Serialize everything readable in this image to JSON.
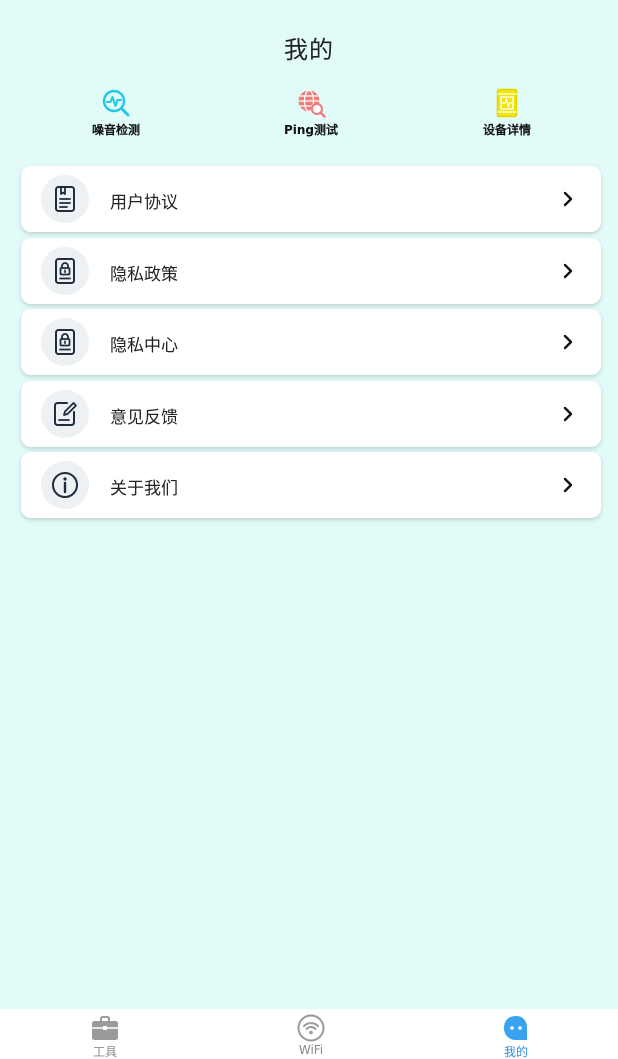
{
  "header": {
    "title": "我的"
  },
  "tools": [
    {
      "label": "噪音检测",
      "icon": "noise-search-icon",
      "color": "#1ec8e6"
    },
    {
      "label": "Ping测试",
      "icon": "globe-search-icon",
      "color": "#f07b7b"
    },
    {
      "label": "设备详情",
      "icon": "phone-device-icon",
      "color": "#f0e60a"
    }
  ],
  "menu": [
    {
      "label": "用户协议",
      "icon": "document-icon"
    },
    {
      "label": "隐私政策",
      "icon": "lock-document-icon"
    },
    {
      "label": "隐私中心",
      "icon": "lock-document-icon"
    },
    {
      "label": "意见反馈",
      "icon": "feedback-edit-icon"
    },
    {
      "label": "关于我们",
      "icon": "info-icon"
    }
  ],
  "tabbar": {
    "items": [
      {
        "label": "工具",
        "icon": "briefcase-icon",
        "active": false
      },
      {
        "label": "WiFi",
        "icon": "wifi-icon",
        "active": false
      },
      {
        "label": "我的",
        "icon": "robot-face-icon",
        "active": true
      }
    ],
    "active_color": "#2f8fe8",
    "inactive_color": "#8a8a8a"
  },
  "colors": {
    "background": "#e1fbf8",
    "card": "#ffffff",
    "text": "#222222"
  }
}
